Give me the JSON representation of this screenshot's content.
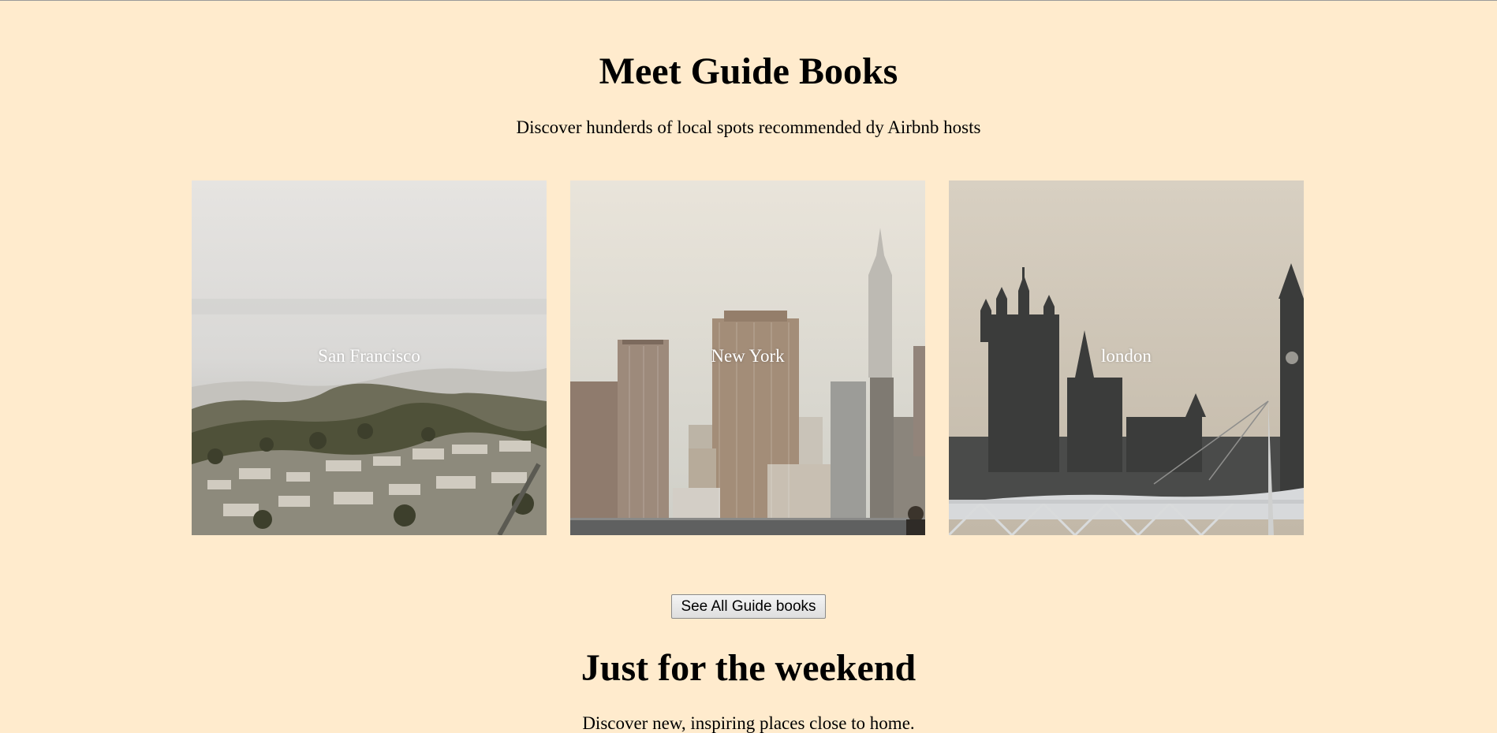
{
  "guide_section": {
    "title": "Meet Guide Books",
    "subtitle": "Discover hunderds of local spots recommended dy Airbnb hosts",
    "cards": [
      {
        "city": "San Francisco"
      },
      {
        "city": "New York"
      },
      {
        "city": "london"
      }
    ],
    "see_all_button": "See All Guide books"
  },
  "weekend_section": {
    "title": "Just for the weekend",
    "subtitle": "Discover new, inspiring places close to home."
  },
  "colors": {
    "page_background": "#FFEBCD",
    "heading_text": "#000000",
    "card_label_text": "#FFFFFF"
  }
}
